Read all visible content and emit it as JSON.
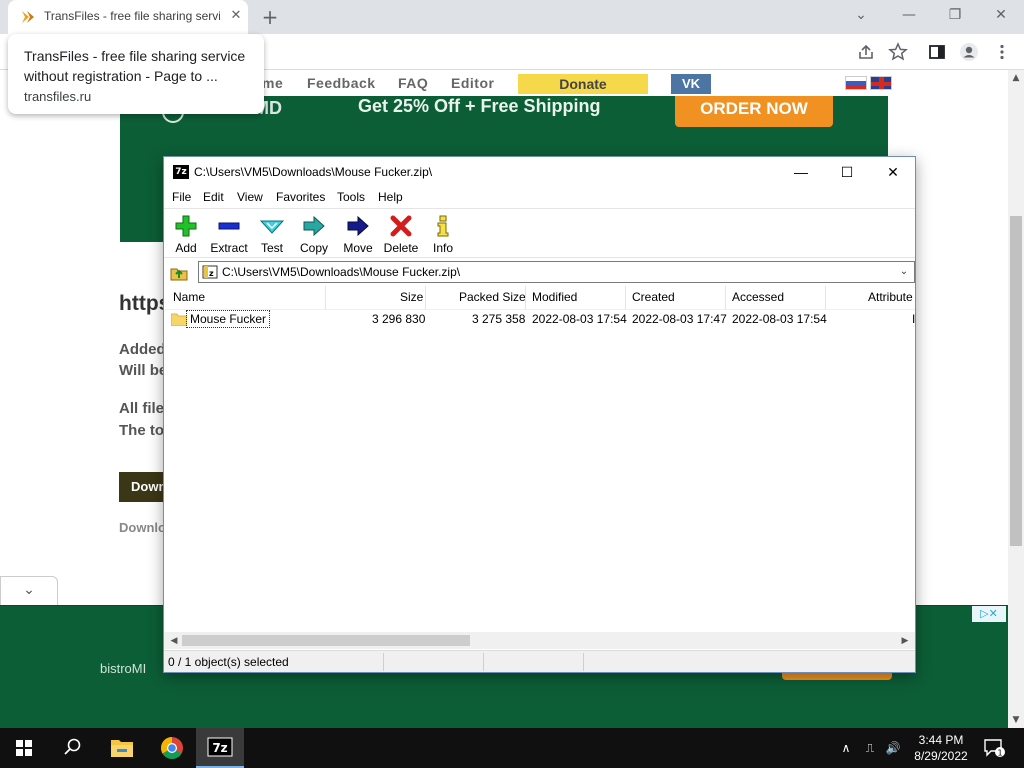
{
  "browser": {
    "tab_title": "TransFiles - free file sharing servi",
    "tab_close": "✕",
    "new_tab": "+",
    "window_controls": {
      "minimize": "⌄",
      "minimize2": "—",
      "restore": "❐",
      "close": "✕"
    },
    "tooltip": {
      "title": "TransFiles - free file sharing service without registration - Page to ...",
      "url": "transfiles.ru"
    }
  },
  "site": {
    "nav": [
      "me",
      "Feedback",
      "FAQ",
      "Editor"
    ],
    "donate": "Donate",
    "vk": "VK",
    "ad_top": {
      "logo": "MD",
      "text": "Get 25% Off + Free Shipping",
      "button": "ORDER NOW"
    },
    "url_heading": "https",
    "lines": [
      "Added",
      "Will be",
      "All file",
      "The to"
    ],
    "download_button": "Down",
    "download_note": "Downlo",
    "ad_bottom": {
      "logo": "bistroMI",
      "choices": "▷✕"
    },
    "collapse": "⌄"
  },
  "sevenzip": {
    "title": "C:\\Users\\VM5\\Downloads\\Mouse Fucker.zip\\",
    "app_icon": "7z",
    "controls": {
      "minimize": "—",
      "maximize": "☐",
      "close": "✕"
    },
    "menu": [
      "File",
      "Edit",
      "View",
      "Favorites",
      "Tools",
      "Help"
    ],
    "toolbar": [
      "Add",
      "Extract",
      "Test",
      "Copy",
      "Move",
      "Delete",
      "Info"
    ],
    "address": "C:\\Users\\VM5\\Downloads\\Mouse Fucker.zip\\",
    "address_dropdown": "⌄",
    "columns": [
      "Name",
      "Size",
      "Packed Size",
      "Modified",
      "Created",
      "Accessed",
      "Attribute"
    ],
    "rows": [
      {
        "name": "Mouse Fucker",
        "size": "3 296 830",
        "packed": "3 275 358",
        "modified": "2022-08-03 17:54",
        "created": "2022-08-03 17:47",
        "accessed": "2022-08-03 17:54",
        "attr": "I"
      }
    ],
    "scroll_left": "◀",
    "scroll_right": "▶",
    "status": "0 / 1 object(s) selected"
  },
  "taskbar": {
    "time": "3:44 PM",
    "date": "8/29/2022",
    "tray": [
      "∧",
      "⎍",
      "🔊"
    ],
    "notifications": "1",
    "sevenzip_label": "7z"
  },
  "colors": {
    "ad_green": "#0c5e37",
    "ad_orange": "#f19121",
    "donate": "#f5d94a",
    "vk": "#4c75a3",
    "taskbar": "#101010"
  }
}
